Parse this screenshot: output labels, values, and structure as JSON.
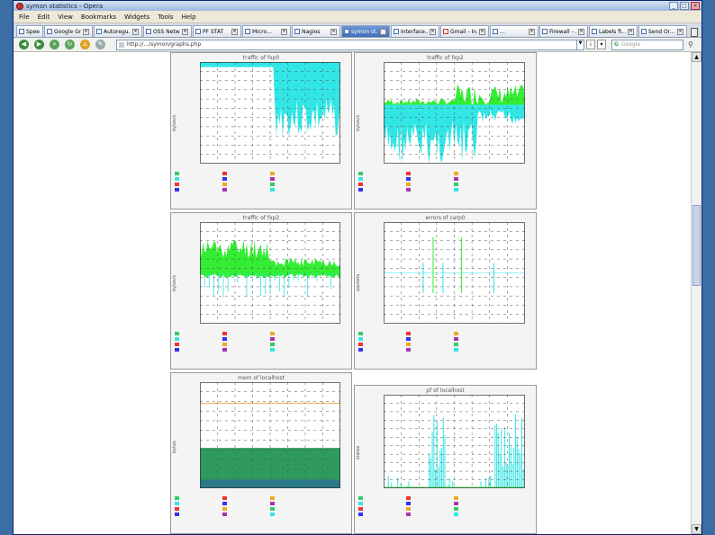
{
  "window": {
    "title": "symon statistics - Opera",
    "buttons": [
      "_",
      "□",
      "×"
    ]
  },
  "menu": [
    "File",
    "Edit",
    "View",
    "Bookmarks",
    "Widgets",
    "Tools",
    "Help"
  ],
  "tabs": [
    {
      "label": "Speed Dial",
      "active": false
    },
    {
      "label": "Google Gr...",
      "active": false
    },
    {
      "label": "Autoregu...",
      "active": false
    },
    {
      "label": "OSS Netw...",
      "active": false
    },
    {
      "label": "PF STAT",
      "active": false
    },
    {
      "label": "Micro...",
      "active": false
    },
    {
      "label": "Nagios",
      "active": false
    },
    {
      "label": "symon st...",
      "active": true
    },
    {
      "label": "Interface...",
      "active": false
    },
    {
      "label": "Gmail - In...",
      "active": false,
      "mail": true
    },
    {
      "label": "...",
      "active": false
    },
    {
      "label": "Firewall - ...",
      "active": false
    },
    {
      "label": "Labels fi...",
      "active": false
    },
    {
      "label": "Send Or...",
      "active": false
    }
  ],
  "address": {
    "value": "http://.../symon/graphs.php",
    "search_placeholder": "Google"
  },
  "graphs": [
    {
      "title": "traffic of fxp0",
      "ylabel": "bytes/s",
      "color": "#33e6e6",
      "mode": "fill-down",
      "seed": 3
    },
    {
      "title": "traffic of fxp2",
      "ylabel": "bytes/s",
      "color": "#33e6e6",
      "mode": "split",
      "seed": 7
    },
    {
      "title": "traffic of fxp2",
      "ylabel": "bytes/s",
      "color": "#33ee33",
      "mode": "green-band",
      "seed": 11
    },
    {
      "title": "errors of carp0",
      "ylabel": "packets",
      "color": "#33ee33",
      "mode": "sparse",
      "seed": 5
    },
    {
      "title": "mem of localhost",
      "ylabel": "bytes",
      "color": "#2e9a5e",
      "mode": "memory",
      "seed": 9
    },
    {
      "title": "pf of localhost",
      "ylabel": "states",
      "color": "#33e6e6",
      "mode": "spikes",
      "seed": 13
    }
  ],
  "legend_colors": [
    "#33cc66",
    "#33e6e6",
    "#ee3333",
    "#3333ee",
    "#eeaa22",
    "#aa33aa"
  ]
}
